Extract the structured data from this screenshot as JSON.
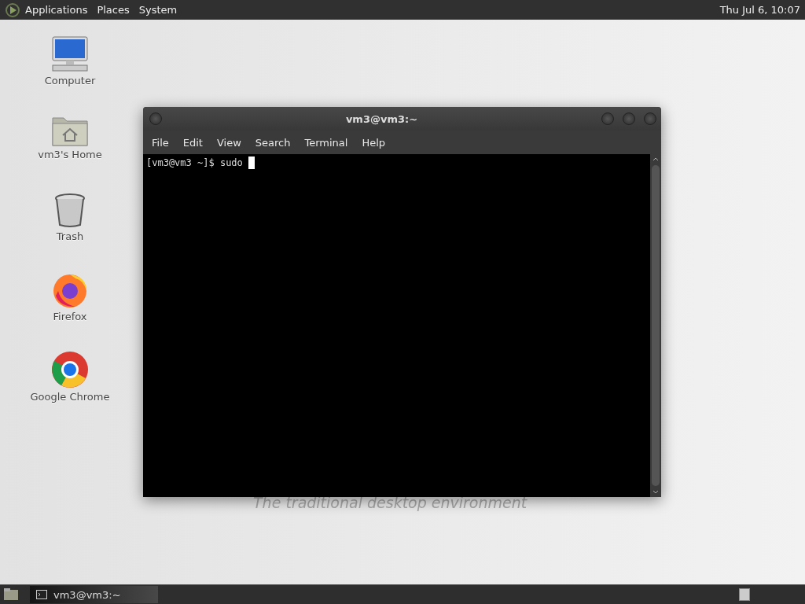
{
  "top_panel": {
    "menus": [
      "Applications",
      "Places",
      "System"
    ],
    "clock": "Thu Jul  6, 10:07"
  },
  "desktop_icons": [
    {
      "kind": "computer",
      "label": "Computer"
    },
    {
      "kind": "home",
      "label": "vm3's Home"
    },
    {
      "kind": "trash",
      "label": "Trash"
    },
    {
      "kind": "firefox",
      "label": "Firefox"
    },
    {
      "kind": "chrome",
      "label": "Google Chrome"
    }
  ],
  "wallpaper_text": "The traditional desktop environment",
  "window": {
    "title": "vm3@vm3:~",
    "menus": [
      "File",
      "Edit",
      "View",
      "Search",
      "Terminal",
      "Help"
    ],
    "prompt": "[vm3@vm3 ~]$ sudo "
  },
  "bottom_panel": {
    "tasks": [
      {
        "label": "vm3@vm3:~",
        "selected": true
      }
    ]
  }
}
